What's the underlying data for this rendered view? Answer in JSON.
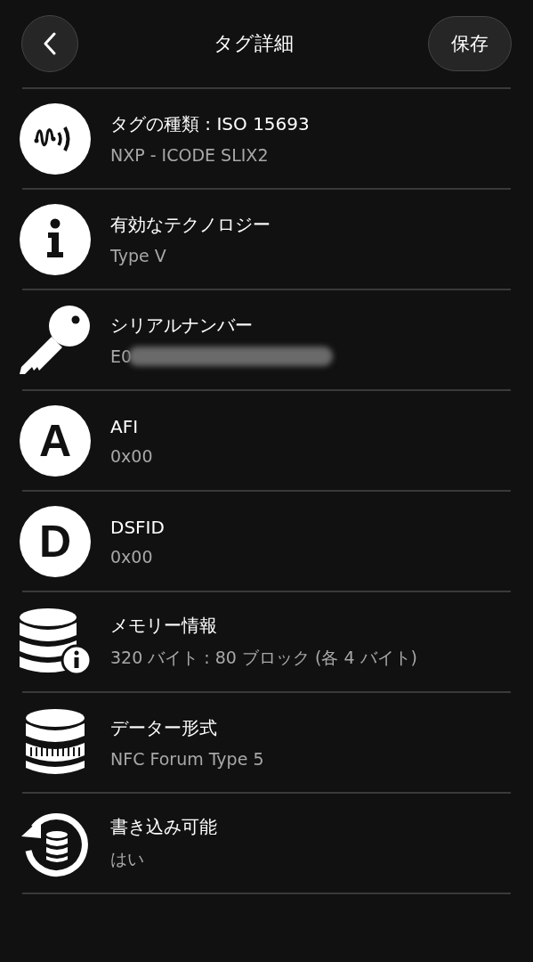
{
  "header": {
    "title": "タグ詳細",
    "save": "保存"
  },
  "rows": [
    {
      "kind": "nfc",
      "title": "タグの種類 : ISO 15693",
      "value": "NXP - ICODE SLIX2"
    },
    {
      "kind": "info",
      "title": "有効なテクノロジー",
      "value": "Type V"
    },
    {
      "kind": "key",
      "title": "シリアルナンバー",
      "value": "E0",
      "redacted": true
    },
    {
      "kind": "letter",
      "letter": "A",
      "title": "AFI",
      "value": "0x00"
    },
    {
      "kind": "letter",
      "letter": "D",
      "title": "DSFID",
      "value": "0x00"
    },
    {
      "kind": "db-info",
      "title": "メモリー情報",
      "value": "320 バイト : 80 ブロック (各 4 バイト)"
    },
    {
      "kind": "db-format",
      "title": "データー形式",
      "value": "NFC Forum Type 5"
    },
    {
      "kind": "db-refresh",
      "title": "書き込み可能",
      "value": "はい"
    }
  ]
}
